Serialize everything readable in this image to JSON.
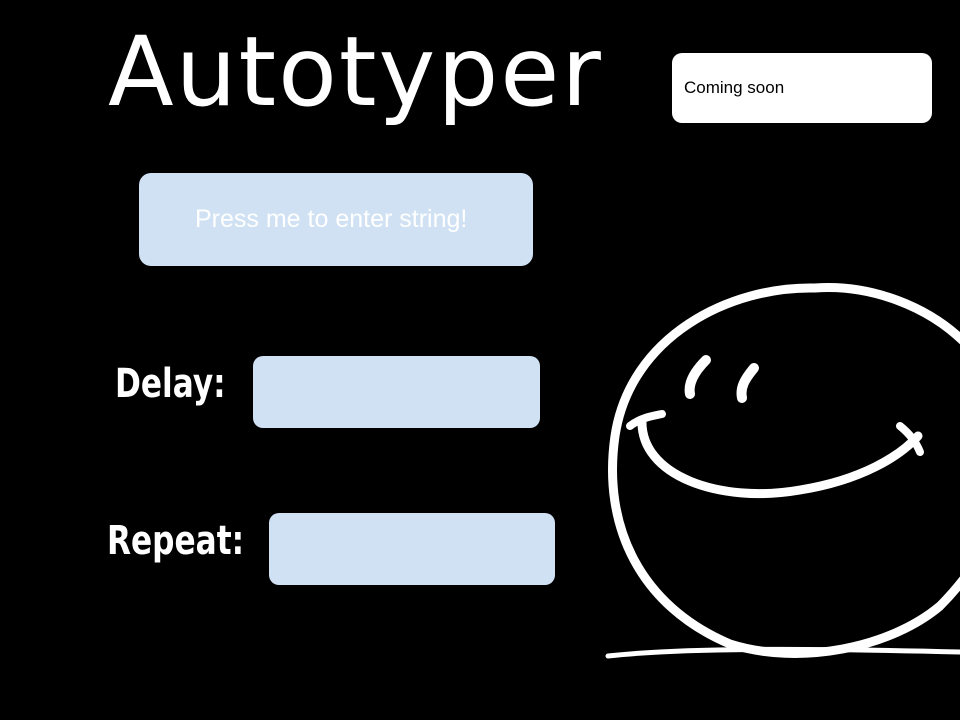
{
  "app": {
    "title": "Autotyper"
  },
  "notice": {
    "text": "Coming soon"
  },
  "enter_string_button": {
    "label": "Press me to enter string!"
  },
  "fields": {
    "delay": {
      "label": "Delay:",
      "value": ""
    },
    "repeat": {
      "label": "Repeat:",
      "value": ""
    }
  },
  "colors": {
    "background": "#000000",
    "button_fill": "#cfe1f3",
    "title_text": "#ffffff",
    "notice_fill": "#ffffff"
  },
  "icons": {
    "decoration": "smiley-face-icon"
  }
}
